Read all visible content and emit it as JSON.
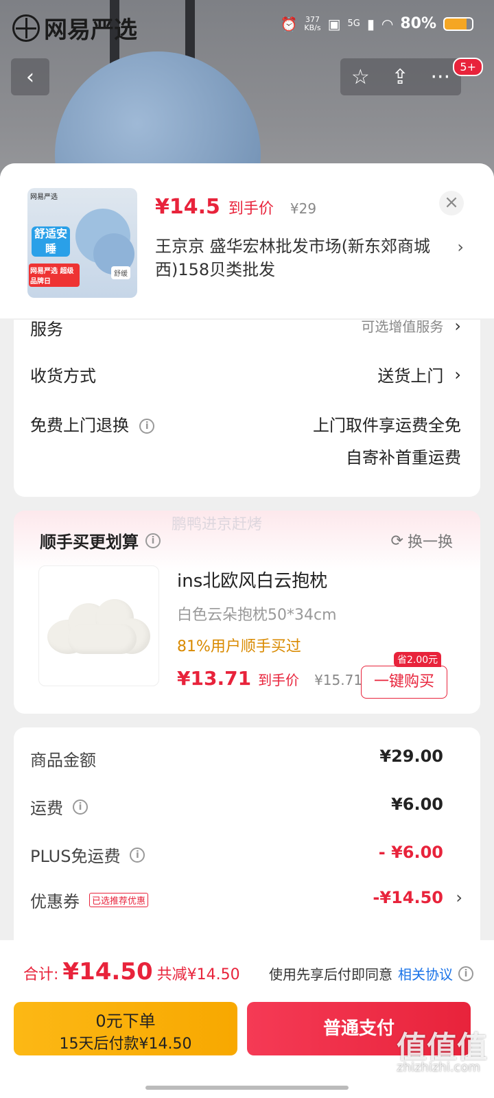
{
  "status_bar": {
    "brand": "网易严选",
    "net_speed": "377",
    "net_unit": "KB/s",
    "signal": "5G",
    "battery": "80%"
  },
  "top_nav": {
    "back": "‹",
    "star": "☆",
    "share": "⇪",
    "more": "···",
    "badge": "5+"
  },
  "product": {
    "thumb_brand": "网易严选",
    "thumb_tag": "舒适安睡",
    "thumb_promo": "网易严选 超级品牌日",
    "thumb_small": "舒缓",
    "price": "¥14.5",
    "price_label": "到手价",
    "orig_price": "¥29",
    "address": "王京京  盛华宏林批发市场(新东郊商城西)158贝类批发"
  },
  "options": {
    "service_label": "服务",
    "service_value": "可选增值服务",
    "delivery_label": "收货方式",
    "delivery_value": "送货上门",
    "return_label": "免费上门退换",
    "return_line1": "上门取件享运费全免",
    "return_line2": "自寄补首重运费"
  },
  "recommend": {
    "title": "顺手买更划算",
    "watermark": "鹏鸭进京赶烤",
    "swap": "换一换",
    "name": "ins北欧风白云抱枕",
    "spec": "白色云朵抱枕50*34cm",
    "bought": "81%用户顺手买过",
    "price": "¥13.71",
    "price_label": "到手价",
    "orig_price": "¥15.71",
    "save_tag": "省2.00元",
    "buy_button": "一键购买"
  },
  "summary": {
    "items": [
      {
        "label": "商品金额",
        "value": "¥29.00"
      },
      {
        "label": "运费",
        "value": "¥6.00"
      },
      {
        "label": "PLUS免运费",
        "value": "- ¥6.00"
      },
      {
        "label": "优惠券",
        "tag": "已选推荐优惠",
        "value": "-¥14.50"
      }
    ]
  },
  "footer": {
    "total_label": "合计:",
    "total_value": "¥14.50",
    "reduced": "共减¥14.50",
    "agree_text": "使用先享后付即同意",
    "agree_link": "相关协议",
    "btn_a_line1": "0元下单",
    "btn_a_line2": "15天后付款¥14.50",
    "btn_b": "普通支付",
    "watermark": "值值值",
    "watermark_url": "zhizhizhi.com"
  },
  "colors": {
    "accent": "#e8233b",
    "orange": "#fcb815",
    "highlight": "#d98a00"
  }
}
